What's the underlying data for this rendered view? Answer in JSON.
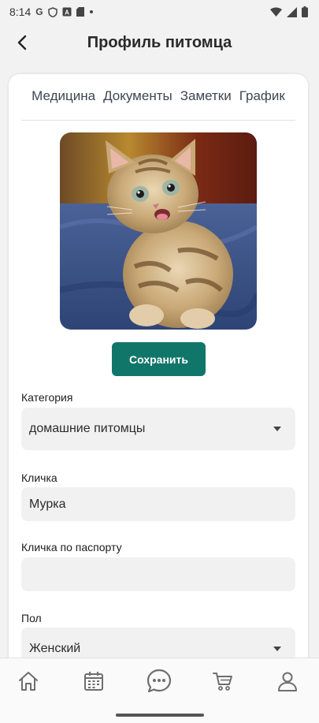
{
  "status_bar": {
    "time": "8:14",
    "icons": [
      "google-icon",
      "shield-icon",
      "a-icon",
      "sim-icon",
      "dot-icon",
      "wifi-icon",
      "signal-icon",
      "battery-icon"
    ]
  },
  "header": {
    "title": "Профиль питомца",
    "back_icon": "chevron-left-icon"
  },
  "tabs": [
    {
      "label": "Медицина"
    },
    {
      "label": "Документы"
    },
    {
      "label": "Заметки"
    },
    {
      "label": "График"
    }
  ],
  "photo": {
    "subject": "kitten"
  },
  "save_button": {
    "label": "Сохранить"
  },
  "form": {
    "category": {
      "label": "Категория",
      "value": "домашние питомцы"
    },
    "nickname": {
      "label": "Кличка",
      "value": "Мурка"
    },
    "passport_nickname": {
      "label": "Кличка по паспорту",
      "value": ""
    },
    "sex": {
      "label": "Пол",
      "value": "Женский"
    }
  },
  "bottom_nav": [
    {
      "icon": "home-icon"
    },
    {
      "icon": "calendar-icon"
    },
    {
      "icon": "chat-icon"
    },
    {
      "icon": "cart-icon"
    },
    {
      "icon": "profile-icon"
    }
  ],
  "colors": {
    "accent": "#11766a",
    "field_bg": "#f1f1f1",
    "page_bg": "#f2f2f2"
  }
}
